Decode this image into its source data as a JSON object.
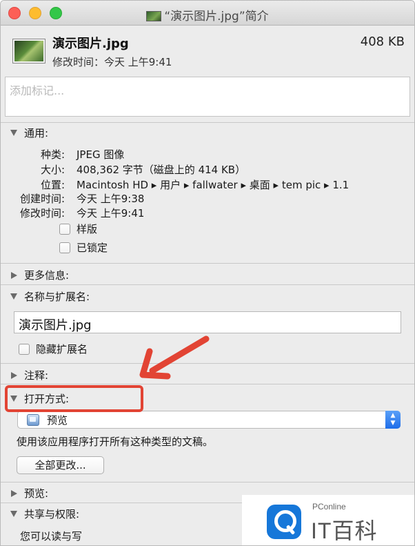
{
  "window": {
    "title": "“演示图片.jpg”简介"
  },
  "header": {
    "file_name": "演示图片.jpg",
    "file_size": "408 KB",
    "modified": "修改时间：今天 上午9:41"
  },
  "tags": {
    "placeholder": "添加标记..."
  },
  "general": {
    "title": "通用:",
    "rows": [
      {
        "label": "种类:",
        "value": "JPEG 图像"
      },
      {
        "label": "大小:",
        "value": "408,362 字节（磁盘上的 414 KB）"
      },
      {
        "label": "位置:",
        "value": "Macintosh HD ▸ 用户 ▸ fallwater ▸ 桌面 ▸ tem pic ▸ 1.1"
      },
      {
        "label": "创建时间:",
        "value": "今天 上午9:38"
      },
      {
        "label": "修改时间:",
        "value": "今天 上午9:41"
      }
    ],
    "stationery_label": "样版",
    "locked_label": "已锁定"
  },
  "more_info": {
    "title": "更多信息:"
  },
  "name_ext": {
    "title": "名称与扩展名:",
    "value": "演示图片.jpg",
    "hide_ext_label": "隐藏扩展名"
  },
  "comments": {
    "title": "注释:"
  },
  "open_with": {
    "title": "打开方式:",
    "app": "预览",
    "note": "使用该应用程序打开所有这种类型的文稿。",
    "change_all": "全部更改..."
  },
  "preview": {
    "title": "预览:"
  },
  "sharing": {
    "title": "共享与权限:",
    "status": "您可以读与写"
  },
  "watermark": {
    "small": "PConline",
    "big": "IT百科"
  },
  "colors": {
    "highlight": "#e24434",
    "accent": "#1f6ee9"
  }
}
